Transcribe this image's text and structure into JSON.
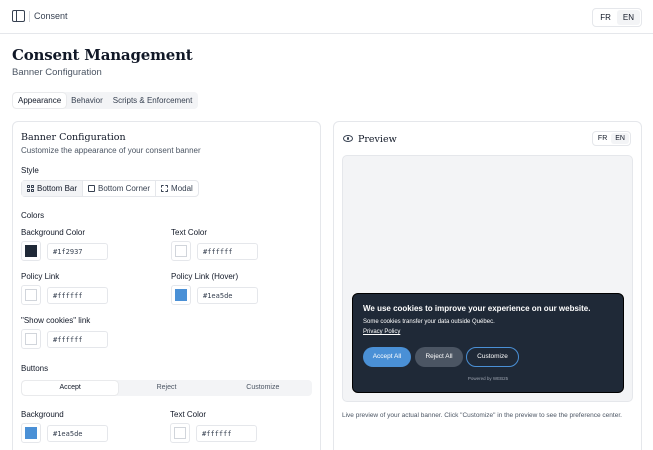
{
  "topbar": {
    "breadcrumb": "Consent",
    "lang": [
      "FR",
      "EN"
    ]
  },
  "page": {
    "title": "Consent Management",
    "subtitle": "Banner Configuration"
  },
  "tabs": [
    "Appearance",
    "Behavior",
    "Scripts & Enforcement"
  ],
  "config": {
    "title": "Banner Configuration",
    "subtitle": "Customize the appearance of your consent banner",
    "style_label": "Style",
    "styles": [
      "Bottom Bar",
      "Bottom Corner",
      "Modal"
    ],
    "colors_label": "Colors",
    "colors": {
      "background": {
        "label": "Background Color",
        "value": "#1f2937"
      },
      "text": {
        "label": "Text Color",
        "value": "#ffffff"
      },
      "policy": {
        "label": "Policy Link",
        "value": "#ffffff"
      },
      "policy_hover": {
        "label": "Policy Link (Hover)",
        "value": "#1ea5de"
      },
      "show_cookies": {
        "label": "\"Show cookies\" link",
        "value": "#ffffff"
      }
    },
    "buttons_label": "Buttons",
    "button_tabs": [
      "Accept",
      "Reject",
      "Customize"
    ],
    "button_colors": {
      "background": {
        "label": "Background",
        "value": "#1ea5de"
      },
      "text": {
        "label": "Text Color",
        "value": "#ffffff"
      }
    }
  },
  "preview": {
    "title": "Preview",
    "lang": [
      "FR",
      "EN"
    ],
    "banner": {
      "title": "We use cookies to improve your experience on our website.",
      "text": "Some cookies transfer your data outside Québec.",
      "policy_link": "Privacy Policy",
      "accept": "Accept All",
      "reject": "Reject All",
      "customize": "Customize",
      "powered": "Powered by WEB25"
    },
    "note": "Live preview of your actual banner. Click \"Customize\" in the preview to see the preference center."
  },
  "swatch_colors": {
    "dark": "#1f2937",
    "white": "#ffffff",
    "blue": "#4a90d6"
  }
}
